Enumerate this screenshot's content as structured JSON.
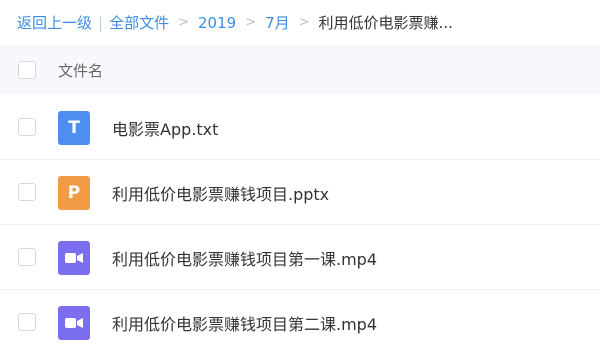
{
  "breadcrumb": {
    "back_label": "返回上一级",
    "separator": "|",
    "items": [
      "全部文件",
      "2019",
      "7月"
    ],
    "current": "利用低价电影票赚..."
  },
  "list": {
    "header_name": "文件名",
    "files": [
      {
        "name": "电影票App.txt",
        "icon": "txt-file-icon",
        "glyph": "T",
        "color": "#4d8ff0"
      },
      {
        "name": "利用低价电影票赚钱项目.pptx",
        "icon": "pptx-file-icon",
        "glyph": "P",
        "color": "#f29b45"
      },
      {
        "name": "利用低价电影票赚钱项目第一课.mp4",
        "icon": "video-file-icon",
        "glyph": "",
        "color": "#7b6ff0"
      },
      {
        "name": "利用低价电影票赚钱项目第二课.mp4",
        "icon": "video-file-icon",
        "glyph": "",
        "color": "#7b6ff0"
      }
    ]
  }
}
